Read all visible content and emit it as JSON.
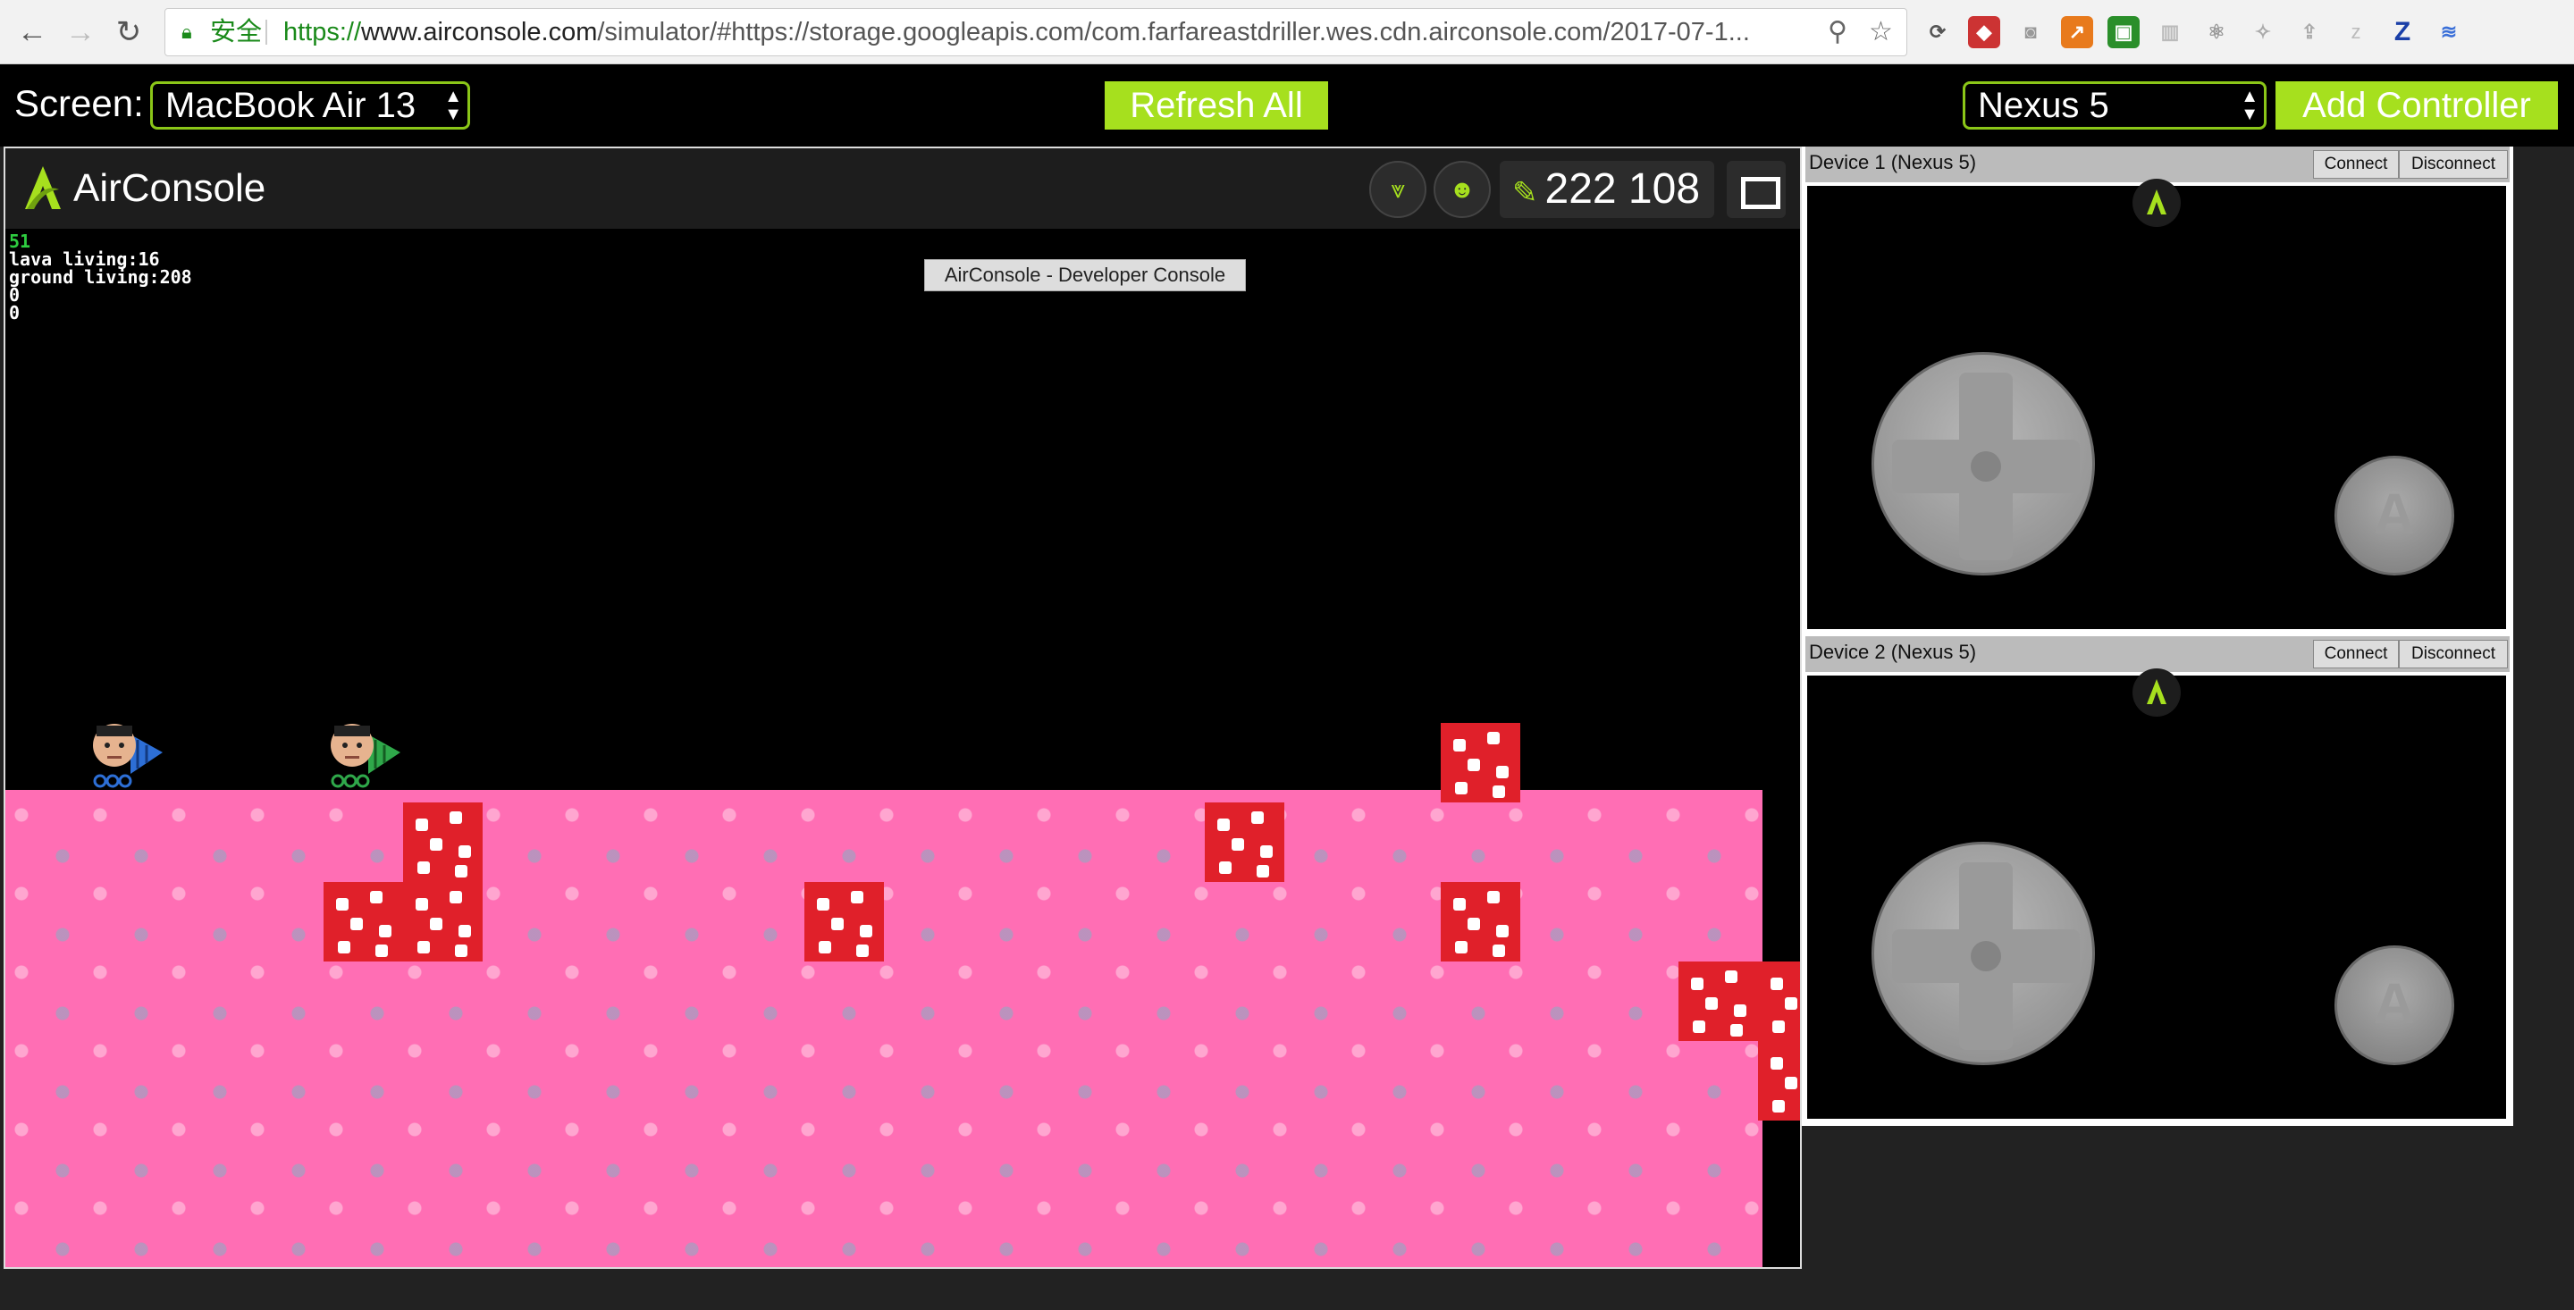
{
  "browser": {
    "secure_label": "安全",
    "url_scheme": "https://",
    "url_host": "www.airconsole.com",
    "url_rest": "/simulator/#https://storage.googleapis.com/com.farfareastdriller.wes.cdn.airconsole.com/2017-07-1..."
  },
  "toolbar": {
    "screen_label": "Screen:",
    "screen_select_value": "MacBook Air 13",
    "refresh_label": "Refresh All",
    "device_select_value": "Nexus 5",
    "add_controller_label": "Add Controller"
  },
  "game": {
    "brand": "AirConsole",
    "code": "222 108",
    "dev_tooltip": "AirConsole - Developer Console",
    "debug": {
      "line1": "51",
      "line2": "lava living:16",
      "line3": "ground living:208",
      "line4": "0",
      "line5": "0"
    }
  },
  "devices": [
    {
      "title": "Device 1 (Nexus 5)",
      "connect": "Connect",
      "disconnect": "Disconnect",
      "button": "A"
    },
    {
      "title": "Device 2 (Nexus 5)",
      "connect": "Connect",
      "disconnect": "Disconnect",
      "button": "A"
    }
  ],
  "colors": {
    "accent": "#a6e01e",
    "ground": "#ff6eb4",
    "block": "#e0202a"
  }
}
